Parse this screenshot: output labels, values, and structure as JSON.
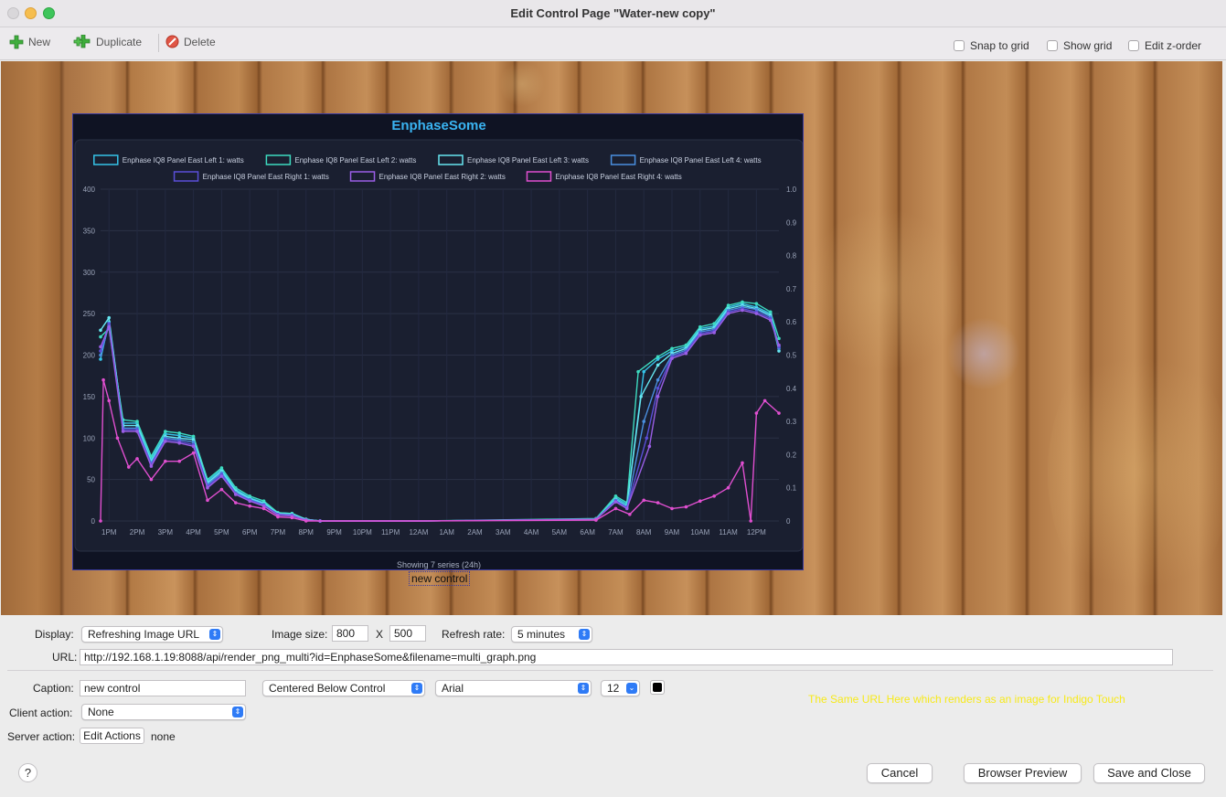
{
  "window": {
    "title": "Edit Control Page \"Water-new copy\""
  },
  "toolbar": {
    "new_label": "New",
    "duplicate_label": "Duplicate",
    "delete_label": "Delete",
    "snap_to_grid": "Snap to grid",
    "show_grid": "Show grid",
    "edit_z_order": "Edit z-order"
  },
  "chart_data": {
    "type": "line",
    "title": "EnphaseSome",
    "footer": "Showing 7 series (24h)",
    "x": [
      "1PM",
      "2PM",
      "3PM",
      "4PM",
      "5PM",
      "6PM",
      "7PM",
      "8PM",
      "9PM",
      "10PM",
      "11PM",
      "12AM",
      "1AM",
      "2AM",
      "3AM",
      "4AM",
      "5AM",
      "6AM",
      "7AM",
      "8AM",
      "9AM",
      "10AM",
      "11AM",
      "12PM"
    ],
    "y_left_ticks": [
      "400",
      "350",
      "300",
      "250",
      "200",
      "150",
      "100",
      "50",
      "0"
    ],
    "y_right_ticks": [
      "1.0",
      "0.9",
      "0.8",
      "0.7",
      "0.6",
      "0.5",
      "0.4",
      "0.3",
      "0.2",
      "0.1",
      "0"
    ],
    "ylim": [
      0,
      400
    ],
    "y2lim": [
      0,
      1.0
    ],
    "legend_position": "top",
    "series": [
      {
        "name": "Enphase IQ8 Panel East Left 1: watts",
        "color": "#35c3e8",
        "values": [
          [
            12.7,
            195
          ],
          [
            13.0,
            240
          ],
          [
            13.5,
            118
          ],
          [
            14.0,
            118
          ],
          [
            14.5,
            75
          ],
          [
            15.0,
            105
          ],
          [
            15.5,
            103
          ],
          [
            16.0,
            100
          ],
          [
            16.5,
            48
          ],
          [
            17.0,
            62
          ],
          [
            17.5,
            38
          ],
          [
            18.0,
            28
          ],
          [
            18.5,
            22
          ],
          [
            19.0,
            10
          ],
          [
            19.5,
            9
          ],
          [
            20.0,
            2
          ],
          [
            20.5,
            0
          ],
          [
            24.0,
            0
          ],
          [
            30.3,
            2
          ],
          [
            31.0,
            28
          ],
          [
            31.4,
            20
          ],
          [
            32.0,
            180
          ],
          [
            32.5,
            195
          ],
          [
            33.0,
            205
          ],
          [
            33.5,
            210
          ],
          [
            34.0,
            232
          ],
          [
            34.5,
            235
          ],
          [
            35.0,
            258
          ],
          [
            35.5,
            262
          ],
          [
            36.0,
            258
          ],
          [
            36.5,
            250
          ],
          [
            36.8,
            210
          ]
        ]
      },
      {
        "name": "Enphase IQ8 Panel East Left 2: watts",
        "color": "#3ddbc0",
        "values": [
          [
            12.7,
            222
          ],
          [
            13.0,
            232
          ],
          [
            13.5,
            122
          ],
          [
            14.0,
            120
          ],
          [
            14.5,
            78
          ],
          [
            15.0,
            108
          ],
          [
            15.5,
            106
          ],
          [
            16.0,
            102
          ],
          [
            16.5,
            50
          ],
          [
            17.0,
            64
          ],
          [
            17.5,
            40
          ],
          [
            18.0,
            30
          ],
          [
            18.5,
            24
          ],
          [
            19.0,
            10
          ],
          [
            19.5,
            9
          ],
          [
            20.0,
            2
          ],
          [
            20.5,
            0
          ],
          [
            24.0,
            0
          ],
          [
            30.3,
            3
          ],
          [
            31.0,
            30
          ],
          [
            31.4,
            22
          ],
          [
            31.8,
            180
          ],
          [
            32.5,
            198
          ],
          [
            33.0,
            208
          ],
          [
            33.5,
            212
          ],
          [
            34.0,
            234
          ],
          [
            34.5,
            238
          ],
          [
            35.0,
            260
          ],
          [
            35.5,
            264
          ],
          [
            36.0,
            262
          ],
          [
            36.5,
            252
          ],
          [
            36.8,
            220
          ]
        ]
      },
      {
        "name": "Enphase IQ8 Panel East Left 3: watts",
        "color": "#66e6f0",
        "values": [
          [
            12.7,
            230
          ],
          [
            13.0,
            245
          ],
          [
            13.5,
            115
          ],
          [
            14.0,
            115
          ],
          [
            14.5,
            72
          ],
          [
            15.0,
            102
          ],
          [
            15.5,
            100
          ],
          [
            16.0,
            98
          ],
          [
            16.5,
            46
          ],
          [
            17.0,
            60
          ],
          [
            17.5,
            36
          ],
          [
            18.0,
            27
          ],
          [
            18.5,
            21
          ],
          [
            19.0,
            9
          ],
          [
            19.5,
            8
          ],
          [
            20.0,
            2
          ],
          [
            20.5,
            0
          ],
          [
            24.0,
            0
          ],
          [
            30.3,
            2
          ],
          [
            31.0,
            26
          ],
          [
            31.4,
            18
          ],
          [
            31.9,
            150
          ],
          [
            32.5,
            188
          ],
          [
            33.0,
            202
          ],
          [
            33.5,
            208
          ],
          [
            34.0,
            230
          ],
          [
            34.5,
            233
          ],
          [
            35.0,
            256
          ],
          [
            35.5,
            260
          ],
          [
            36.0,
            256
          ],
          [
            36.5,
            248
          ],
          [
            36.8,
            205
          ]
        ]
      },
      {
        "name": "Enphase IQ8 Panel East Left 4: watts",
        "color": "#4a8fe0",
        "values": [
          [
            12.7,
            200
          ],
          [
            13.0,
            236
          ],
          [
            13.5,
            112
          ],
          [
            14.0,
            112
          ],
          [
            14.5,
            70
          ],
          [
            15.0,
            100
          ],
          [
            15.5,
            98
          ],
          [
            16.0,
            95
          ],
          [
            16.5,
            44
          ],
          [
            17.0,
            58
          ],
          [
            17.5,
            34
          ],
          [
            18.0,
            26
          ],
          [
            18.5,
            20
          ],
          [
            19.0,
            8
          ],
          [
            19.5,
            7
          ],
          [
            20.0,
            1
          ],
          [
            20.5,
            0
          ],
          [
            24.0,
            0
          ],
          [
            30.3,
            2
          ],
          [
            31.0,
            25
          ],
          [
            31.4,
            17
          ],
          [
            32.0,
            120
          ],
          [
            32.5,
            170
          ],
          [
            33.0,
            200
          ],
          [
            33.5,
            206
          ],
          [
            34.0,
            228
          ],
          [
            34.5,
            231
          ],
          [
            35.0,
            254
          ],
          [
            35.5,
            258
          ],
          [
            36.0,
            255
          ],
          [
            36.5,
            246
          ],
          [
            36.8,
            208
          ]
        ]
      },
      {
        "name": "Enphase IQ8 Panel East Right 1: watts",
        "color": "#5a4fd8",
        "values": [
          [
            12.7,
            205
          ],
          [
            13.0,
            238
          ],
          [
            13.5,
            110
          ],
          [
            14.0,
            110
          ],
          [
            14.5,
            68
          ],
          [
            15.0,
            98
          ],
          [
            15.5,
            96
          ],
          [
            16.0,
            92
          ],
          [
            16.5,
            42
          ],
          [
            17.0,
            56
          ],
          [
            17.5,
            33
          ],
          [
            18.0,
            25
          ],
          [
            18.5,
            19
          ],
          [
            19.0,
            8
          ],
          [
            19.5,
            7
          ],
          [
            20.0,
            1
          ],
          [
            20.5,
            0
          ],
          [
            24.0,
            0
          ],
          [
            30.3,
            2
          ],
          [
            31.0,
            24
          ],
          [
            31.4,
            16
          ],
          [
            32.1,
            100
          ],
          [
            32.5,
            160
          ],
          [
            33.0,
            198
          ],
          [
            33.5,
            204
          ],
          [
            34.0,
            226
          ],
          [
            34.5,
            229
          ],
          [
            35.0,
            252
          ],
          [
            35.5,
            256
          ],
          [
            36.0,
            252
          ],
          [
            36.5,
            244
          ],
          [
            36.8,
            210
          ]
        ]
      },
      {
        "name": "Enphase IQ8 Panel East Right 2: watts",
        "color": "#9a5ee6",
        "values": [
          [
            12.7,
            210
          ],
          [
            13.0,
            234
          ],
          [
            13.5,
            108
          ],
          [
            14.0,
            108
          ],
          [
            14.5,
            66
          ],
          [
            15.0,
            96
          ],
          [
            15.5,
            94
          ],
          [
            16.0,
            90
          ],
          [
            16.5,
            40
          ],
          [
            17.0,
            54
          ],
          [
            17.5,
            32
          ],
          [
            18.0,
            24
          ],
          [
            18.5,
            18
          ],
          [
            19.0,
            7
          ],
          [
            19.5,
            6
          ],
          [
            20.0,
            1
          ],
          [
            20.5,
            0
          ],
          [
            24.0,
            0
          ],
          [
            30.3,
            2
          ],
          [
            31.0,
            23
          ],
          [
            31.4,
            15
          ],
          [
            32.2,
            90
          ],
          [
            32.5,
            150
          ],
          [
            33.0,
            196
          ],
          [
            33.5,
            202
          ],
          [
            34.0,
            224
          ],
          [
            34.5,
            227
          ],
          [
            35.0,
            250
          ],
          [
            35.5,
            254
          ],
          [
            36.0,
            250
          ],
          [
            36.5,
            242
          ],
          [
            36.8,
            212
          ]
        ]
      },
      {
        "name": "Enphase IQ8 Panel East Right 4: watts",
        "color": "#e04fd0",
        "values": [
          [
            12.7,
            0
          ],
          [
            12.8,
            170
          ],
          [
            13.0,
            145
          ],
          [
            13.3,
            100
          ],
          [
            13.7,
            65
          ],
          [
            14.0,
            75
          ],
          [
            14.5,
            50
          ],
          [
            15.0,
            72
          ],
          [
            15.5,
            72
          ],
          [
            16.0,
            82
          ],
          [
            16.5,
            25
          ],
          [
            17.0,
            38
          ],
          [
            17.5,
            22
          ],
          [
            18.0,
            18
          ],
          [
            18.5,
            15
          ],
          [
            19.0,
            5
          ],
          [
            19.5,
            4
          ],
          [
            20.0,
            0
          ],
          [
            24.0,
            0
          ],
          [
            30.3,
            1
          ],
          [
            31.0,
            15
          ],
          [
            31.5,
            8
          ],
          [
            32.0,
            25
          ],
          [
            32.5,
            22
          ],
          [
            33.0,
            15
          ],
          [
            33.5,
            17
          ],
          [
            34.0,
            24
          ],
          [
            34.5,
            30
          ],
          [
            35.0,
            40
          ],
          [
            35.5,
            70
          ],
          [
            35.8,
            0
          ],
          [
            36.0,
            130
          ],
          [
            36.3,
            145
          ],
          [
            36.8,
            130
          ]
        ]
      }
    ]
  },
  "canvas": {
    "caption_text": "new control"
  },
  "form": {
    "display_label": "Display:",
    "display_value": "Refreshing Image URL",
    "image_size_label": "Image size:",
    "image_width": "800",
    "size_x": "X",
    "image_height": "500",
    "refresh_rate_label": "Refresh rate:",
    "refresh_rate_value": "5 minutes",
    "url_label": "URL:",
    "url_value": "http://192.168.1.19:8088/api/render_png_multi?id=EnphaseSome&filename=multi_graph.png",
    "caption_label": "Caption:",
    "caption_value": "new control",
    "caption_position": "Centered Below Control",
    "font_value": "Arial",
    "font_size": "12",
    "client_action_label": "Client action:",
    "client_action_value": "None",
    "server_action_label": "Server action:",
    "edit_actions_label": "Edit Actions",
    "server_action_value": "none",
    "note": "The Same URL Here which renders as an image for Indigo Touch"
  },
  "buttons": {
    "help": "?",
    "cancel": "Cancel",
    "browser_preview": "Browser Preview",
    "save_and_close": "Save and Close"
  }
}
